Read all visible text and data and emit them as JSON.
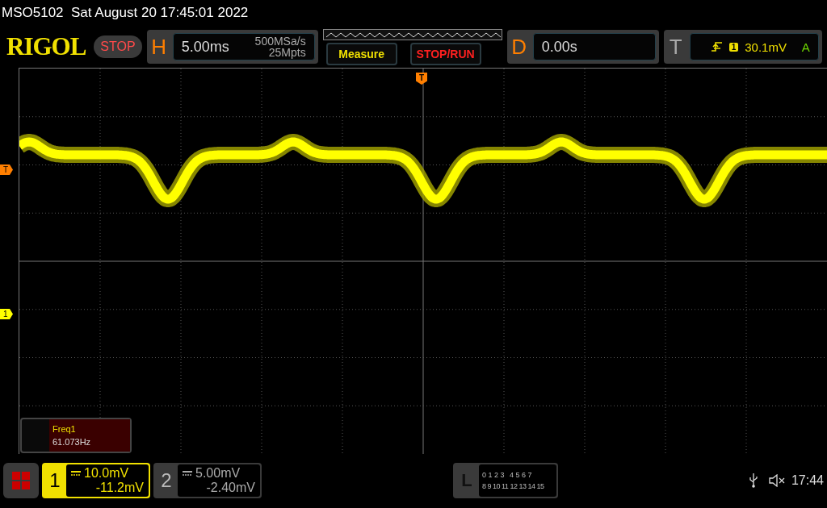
{
  "title": "MSO5102  Sat August 20 17:45:01 2022",
  "logo": "RIGOL",
  "run_state": "STOP",
  "horizontal": {
    "letter": "H",
    "timebase": "5.00ms",
    "sample_rate": "500MSa/s",
    "memory_depth": "25Mpts"
  },
  "buttons": [
    {
      "label": "Measure",
      "kind": "measure"
    },
    {
      "label": "STOP/RUN",
      "kind": "run"
    }
  ],
  "delay": {
    "letter": "D",
    "value": "0.00s"
  },
  "trigger": {
    "letter": "T",
    "source": "1",
    "level": "30.1mV",
    "mode": "A"
  },
  "top_marker": "T",
  "markers": [
    {
      "label": "T",
      "color": "#ff7f00"
    },
    {
      "label": "1",
      "color": "#ffff00"
    }
  ],
  "measurements": [
    {
      "name": "Freq1",
      "value": "61.073Hz"
    }
  ],
  "channels": [
    {
      "number": "1",
      "scale": "10.0mV",
      "offset": "-11.2mV",
      "selected": true
    },
    {
      "number": "2",
      "scale": "5.00mV",
      "offset": "-2.40mV",
      "selected": false
    }
  ],
  "logic": {
    "letter": "L",
    "row_1": [
      "0",
      "1",
      "2",
      "3",
      "4",
      "5",
      "6",
      "7"
    ],
    "row_2": [
      "8",
      "9",
      "10",
      "11",
      "12",
      "13",
      "14",
      "15"
    ]
  },
  "status": {
    "time": "17:44"
  }
}
